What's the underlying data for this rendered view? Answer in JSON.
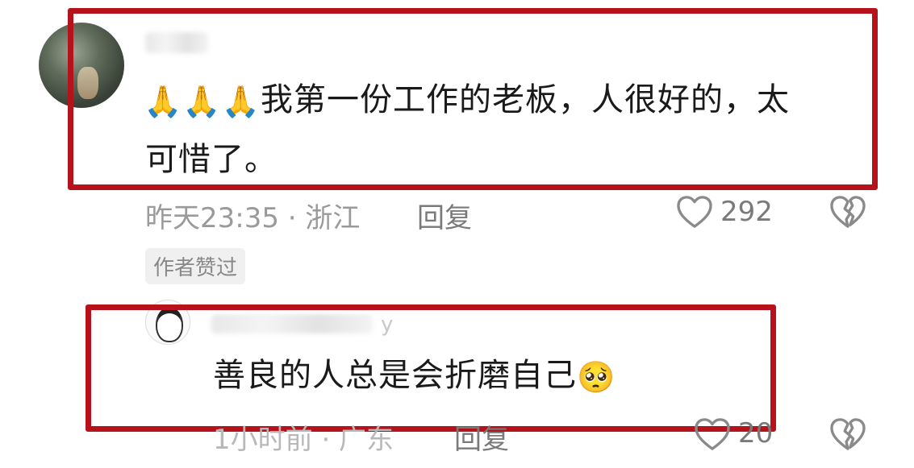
{
  "comment": {
    "emojis": "🙏🙏🙏",
    "text_line1": "我第一份工作的老板，人很好的，太",
    "text_line2": "可惜了。",
    "time_location": "昨天23:35 · 浙江",
    "reply_label": "回复",
    "like_count": "292",
    "author_badge": "作者赞过"
  },
  "reply": {
    "name_tail": "y",
    "text": "善良的人总是会折磨自己",
    "emoji": "🥺",
    "time_location": "1小时前 · 广东",
    "reply_label": "回复",
    "like_count": "20"
  },
  "colors": {
    "highlight": "#b5121b",
    "meta_text": "#9a9a9a"
  }
}
